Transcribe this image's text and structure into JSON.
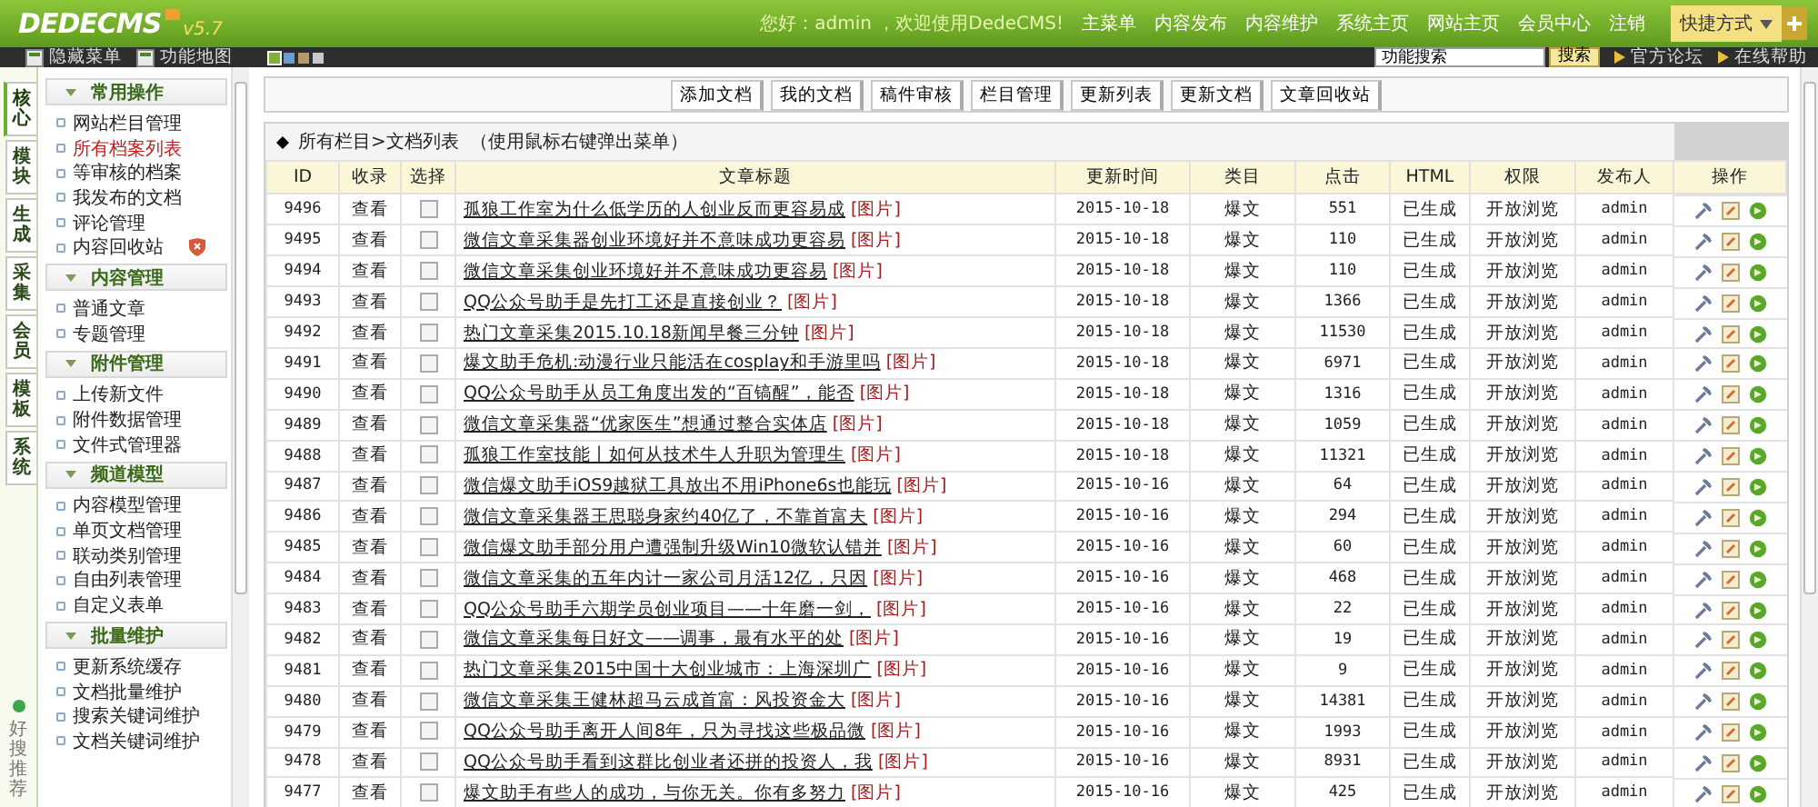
{
  "header": {
    "logo": "DEDECMS",
    "version": "v5.7",
    "greeting": "您好：admin ，欢迎使用DedeCMS!",
    "nav": [
      "主菜单",
      "内容发布",
      "内容维护",
      "系统主页",
      "网站主页",
      "会员中心",
      "注销"
    ],
    "shortcut": "快捷方式"
  },
  "toolbar": {
    "links": [
      "隐藏菜单",
      "功能地图"
    ],
    "skins": [
      {
        "color": "#7fb23a",
        "selected": true
      },
      {
        "color": "#6a9ccc",
        "selected": false
      },
      {
        "color": "#b49a6a",
        "selected": false
      },
      {
        "color": "#c8c8c8",
        "selected": false
      }
    ],
    "search_value": "功能搜索",
    "search_button": "搜索",
    "help_links": [
      "官方论坛",
      "在线帮助"
    ]
  },
  "side_tabs": [
    {
      "label": "核心",
      "selected": true
    },
    {
      "label": "模块",
      "selected": false
    },
    {
      "label": "生成",
      "selected": false
    },
    {
      "label": "采集",
      "selected": false
    },
    {
      "label": "会员",
      "selected": false
    },
    {
      "label": "模板",
      "selected": false
    },
    {
      "label": "系统",
      "selected": false
    }
  ],
  "recommend": "好搜推荐",
  "menu": [
    {
      "title": "常用操作",
      "items": [
        {
          "label": "网站栏目管理",
          "selected": false
        },
        {
          "label": "所有档案列表",
          "selected": true
        },
        {
          "label": "等审核的档案",
          "selected": false
        },
        {
          "label": "我发布的文档",
          "selected": false
        },
        {
          "label": "评论管理",
          "selected": false
        },
        {
          "label": "内容回收站",
          "selected": false,
          "badge": true
        }
      ]
    },
    {
      "title": "内容管理",
      "items": [
        {
          "label": "普通文章",
          "selected": false
        },
        {
          "label": "专题管理",
          "selected": false
        }
      ]
    },
    {
      "title": "附件管理",
      "items": [
        {
          "label": "上传新文件",
          "selected": false
        },
        {
          "label": "附件数据管理",
          "selected": false
        },
        {
          "label": "文件式管理器",
          "selected": false
        }
      ]
    },
    {
      "title": "频道模型",
      "items": [
        {
          "label": "内容模型管理",
          "selected": false
        },
        {
          "label": "单页文档管理",
          "selected": false
        },
        {
          "label": "联动类别管理",
          "selected": false
        },
        {
          "label": "自由列表管理",
          "selected": false
        },
        {
          "label": "自定义表单",
          "selected": false
        }
      ]
    },
    {
      "title": "批量维护",
      "items": [
        {
          "label": "更新系统缓存",
          "selected": false
        },
        {
          "label": "文档批量维护",
          "selected": false
        },
        {
          "label": "搜索关键词维护",
          "selected": false
        },
        {
          "label": "文档关键词维护",
          "selected": false
        }
      ]
    }
  ],
  "actions": [
    "添加文档",
    "我的文档",
    "稿件审核",
    "栏目管理",
    "更新列表",
    "更新文档",
    "文章回收站"
  ],
  "caption": "所有栏目>文档列表  （使用鼠标右键弹出菜单）",
  "columns": [
    "ID",
    "收录",
    "选择",
    "文章标题",
    "更新时间",
    "类目",
    "点击",
    "HTML",
    "权限",
    "发布人",
    "操作"
  ],
  "rows": [
    {
      "id": "9496",
      "view": "查看",
      "checked": false,
      "title": "孤狼工作室为什么低学历的人创业反而更容易成",
      "tag": "[图片]",
      "date": "2015-10-18",
      "category": "爆文",
      "clicks": "551",
      "html": "已生成",
      "permission": "开放浏览",
      "publisher": "admin"
    },
    {
      "id": "9495",
      "view": "查看",
      "checked": false,
      "title": "微信文章采集器创业环境好并不意味成功更容易",
      "tag": "[图片]",
      "date": "2015-10-18",
      "category": "爆文",
      "clicks": "110",
      "html": "已生成",
      "permission": "开放浏览",
      "publisher": "admin"
    },
    {
      "id": "9494",
      "view": "查看",
      "checked": false,
      "title": "微信文章采集创业环境好并不意味成功更容易",
      "tag": "[图片]",
      "date": "2015-10-18",
      "category": "爆文",
      "clicks": "110",
      "html": "已生成",
      "permission": "开放浏览",
      "publisher": "admin"
    },
    {
      "id": "9493",
      "view": "查看",
      "checked": false,
      "title": "QQ公众号助手是先打工还是直接创业？",
      "tag": "[图片]",
      "date": "2015-10-18",
      "category": "爆文",
      "clicks": "1366",
      "html": "已生成",
      "permission": "开放浏览",
      "publisher": "admin"
    },
    {
      "id": "9492",
      "view": "查看",
      "checked": false,
      "title": "热门文章采集2015.10.18新闻早餐三分钟",
      "tag": "[图片]",
      "date": "2015-10-18",
      "category": "爆文",
      "clicks": "11530",
      "html": "已生成",
      "permission": "开放浏览",
      "publisher": "admin"
    },
    {
      "id": "9491",
      "view": "查看",
      "checked": false,
      "title": "爆文助手危机:动漫行业只能活在cosplay和手游里吗",
      "tag": "[图片]",
      "date": "2015-10-18",
      "category": "爆文",
      "clicks": "6971",
      "html": "已生成",
      "permission": "开放浏览",
      "publisher": "admin"
    },
    {
      "id": "9490",
      "view": "查看",
      "checked": false,
      "title": "QQ公众号助手从员工角度出发的“百镐醒”，能否",
      "tag": "[图片]",
      "date": "2015-10-18",
      "category": "爆文",
      "clicks": "1316",
      "html": "已生成",
      "permission": "开放浏览",
      "publisher": "admin"
    },
    {
      "id": "9489",
      "view": "查看",
      "checked": false,
      "title": "微信文章采集器“优家医生”想通过整合实体店",
      "tag": "[图片]",
      "date": "2015-10-18",
      "category": "爆文",
      "clicks": "1059",
      "html": "已生成",
      "permission": "开放浏览",
      "publisher": "admin"
    },
    {
      "id": "9488",
      "view": "查看",
      "checked": false,
      "title": "孤狼工作室技能丨如何从技术牛人升职为管理生",
      "tag": "[图片]",
      "date": "2015-10-18",
      "category": "爆文",
      "clicks": "11321",
      "html": "已生成",
      "permission": "开放浏览",
      "publisher": "admin"
    },
    {
      "id": "9487",
      "view": "查看",
      "checked": false,
      "title": "微信爆文助手iOS9越狱工具放出不用iPhone6s也能玩",
      "tag": "[图片]",
      "date": "2015-10-16",
      "category": "爆文",
      "clicks": "64",
      "html": "已生成",
      "permission": "开放浏览",
      "publisher": "admin"
    },
    {
      "id": "9486",
      "view": "查看",
      "checked": false,
      "title": "微信文章采集器王思聪身家约40亿了，不靠首富夫",
      "tag": "[图片]",
      "date": "2015-10-16",
      "category": "爆文",
      "clicks": "294",
      "html": "已生成",
      "permission": "开放浏览",
      "publisher": "admin"
    },
    {
      "id": "9485",
      "view": "查看",
      "checked": false,
      "title": "微信爆文助手部分用户遭强制升级Win10微软认错并",
      "tag": "[图片]",
      "date": "2015-10-16",
      "category": "爆文",
      "clicks": "60",
      "html": "已生成",
      "permission": "开放浏览",
      "publisher": "admin"
    },
    {
      "id": "9484",
      "view": "查看",
      "checked": false,
      "title": "微信文章采集的五年内计一家公司月活12亿，只因",
      "tag": "[图片]",
      "date": "2015-10-16",
      "category": "爆文",
      "clicks": "468",
      "html": "已生成",
      "permission": "开放浏览",
      "publisher": "admin"
    },
    {
      "id": "9483",
      "view": "查看",
      "checked": false,
      "title": "QQ公众号助手六期学员创业项目——十年磨一剑，",
      "tag": "[图片]",
      "date": "2015-10-16",
      "category": "爆文",
      "clicks": "22",
      "html": "已生成",
      "permission": "开放浏览",
      "publisher": "admin"
    },
    {
      "id": "9482",
      "view": "查看",
      "checked": false,
      "title": "微信文章采集每日好文——调事，最有水平的处",
      "tag": "[图片]",
      "date": "2015-10-16",
      "category": "爆文",
      "clicks": "19",
      "html": "已生成",
      "permission": "开放浏览",
      "publisher": "admin"
    },
    {
      "id": "9481",
      "view": "查看",
      "checked": false,
      "title": "热门文章采集2015中国十大创业城市：上海深圳广",
      "tag": "[图片]",
      "date": "2015-10-16",
      "category": "爆文",
      "clicks": "9",
      "html": "已生成",
      "permission": "开放浏览",
      "publisher": "admin"
    },
    {
      "id": "9480",
      "view": "查看",
      "checked": false,
      "title": "微信文章采集王健林超马云成首富：风投资金大",
      "tag": "[图片]",
      "date": "2015-10-16",
      "category": "爆文",
      "clicks": "14381",
      "html": "已生成",
      "permission": "开放浏览",
      "publisher": "admin"
    },
    {
      "id": "9479",
      "view": "查看",
      "checked": false,
      "title": "QQ公众号助手离开人间8年，只为寻找这些极品微",
      "tag": "[图片]",
      "date": "2015-10-16",
      "category": "爆文",
      "clicks": "1993",
      "html": "已生成",
      "permission": "开放浏览",
      "publisher": "admin"
    },
    {
      "id": "9478",
      "view": "查看",
      "checked": false,
      "title": "QQ公众号助手看到这群比创业者还拼的投资人，我",
      "tag": "[图片]",
      "date": "2015-10-16",
      "category": "爆文",
      "clicks": "8931",
      "html": "已生成",
      "permission": "开放浏览",
      "publisher": "admin"
    },
    {
      "id": "9477",
      "view": "查看",
      "checked": false,
      "title": "爆文助手有些人的成功，与你无关。你有多努力",
      "tag": "[图片]",
      "date": "2015-10-16",
      "category": "爆文",
      "clicks": "425",
      "html": "已生成",
      "permission": "开放浏览",
      "publisher": "admin"
    }
  ]
}
